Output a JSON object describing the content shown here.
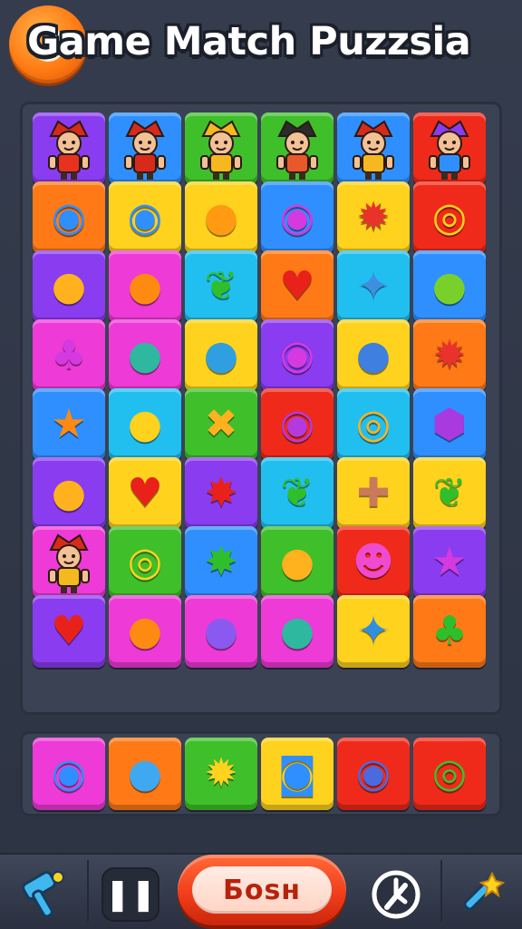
{
  "header": {
    "title": "Game Match Puzzsia",
    "coin_icon": "coin-icon"
  },
  "palette": {
    "purple": "#8a3cf0",
    "blue": "#2f8fff",
    "green": "#3fbf2a",
    "orange": "#ff7a16",
    "yellow": "#ffd21e",
    "red": "#f02a1a",
    "magenta": "#ee3ad6",
    "cyan": "#21bff0",
    "violet": "#8a3cf0"
  },
  "board": {
    "rows": [
      [
        {
          "color": "purple",
          "kind": "character",
          "hat": "#d82a1a",
          "shirt": "#e8321f"
        },
        {
          "color": "blue",
          "kind": "character",
          "hat": "#d82a1a",
          "shirt": "#d82a1a"
        },
        {
          "color": "green",
          "kind": "character",
          "hat": "#f5b81e",
          "shirt": "#f5b81e"
        },
        {
          "color": "green",
          "kind": "character",
          "hat": "#2b2b2b",
          "shirt": "#e8582a"
        },
        {
          "color": "blue",
          "kind": "character",
          "hat": "#d82a1a",
          "shirt": "#f5b81e"
        },
        {
          "color": "red",
          "kind": "character",
          "hat": "#8a3cf0",
          "shirt": "#2f8fff"
        }
      ],
      [
        {
          "color": "orange",
          "kind": "gem",
          "icon": "ring-icon",
          "glyph": "◉",
          "glyph_color": "#2f8fff"
        },
        {
          "color": "yellow",
          "kind": "gem",
          "icon": "ring-icon",
          "glyph": "◉",
          "glyph_color": "#2f8fff"
        },
        {
          "color": "yellow",
          "kind": "gem",
          "icon": "bell-icon",
          "glyph": "●",
          "glyph_color": "#ff9a12"
        },
        {
          "color": "blue",
          "kind": "gem",
          "icon": "ring-icon",
          "glyph": "◉",
          "glyph_color": "#d43ae0"
        },
        {
          "color": "yellow",
          "kind": "gem",
          "icon": "gear-icon",
          "glyph": "✹",
          "glyph_color": "#e8322a"
        },
        {
          "color": "red",
          "kind": "gem",
          "icon": "ring-icon",
          "glyph": "◎",
          "glyph_color": "#ffd21e"
        }
      ],
      [
        {
          "color": "purple",
          "kind": "gem",
          "icon": "bell-icon",
          "glyph": "●",
          "glyph_color": "#ffb21e"
        },
        {
          "color": "magenta",
          "kind": "gem",
          "icon": "bell-icon",
          "glyph": "●",
          "glyph_color": "#ff8a12"
        },
        {
          "color": "cyan",
          "kind": "gem",
          "icon": "leaf-icon",
          "glyph": "❦",
          "glyph_color": "#2fbf2a"
        },
        {
          "color": "orange",
          "kind": "gem",
          "icon": "heart-icon",
          "glyph": "♥",
          "glyph_color": "#e8221a"
        },
        {
          "color": "cyan",
          "kind": "gem",
          "icon": "shell-icon",
          "glyph": "✦",
          "glyph_color": "#3f8fe0"
        },
        {
          "color": "blue",
          "kind": "gem",
          "icon": "drop-icon",
          "glyph": "●",
          "glyph_color": "#7ad02a"
        }
      ],
      [
        {
          "color": "magenta",
          "kind": "gem",
          "icon": "blob-icon",
          "glyph": "♣",
          "glyph_color": "#d43ae0"
        },
        {
          "color": "magenta",
          "kind": "gem",
          "icon": "planet-icon",
          "glyph": "●",
          "glyph_color": "#2fb8a0"
        },
        {
          "color": "yellow",
          "kind": "gem",
          "icon": "drop-icon",
          "glyph": "●",
          "glyph_color": "#2f9fe0"
        },
        {
          "color": "purple",
          "kind": "gem",
          "icon": "ring-icon",
          "glyph": "◉",
          "glyph_color": "#d43ae0"
        },
        {
          "color": "yellow",
          "kind": "gem",
          "icon": "planet-icon",
          "glyph": "●",
          "glyph_color": "#3f7fe0"
        },
        {
          "color": "orange",
          "kind": "gem",
          "icon": "gear-icon",
          "glyph": "✹",
          "glyph_color": "#e8322a"
        }
      ],
      [
        {
          "color": "blue",
          "kind": "gem",
          "icon": "star-icon",
          "glyph": "★",
          "glyph_color": "#ff8a12"
        },
        {
          "color": "cyan",
          "kind": "gem",
          "icon": "drop-icon",
          "glyph": "●",
          "glyph_color": "#ffd21e"
        },
        {
          "color": "green",
          "kind": "gem",
          "icon": "cross-icon",
          "glyph": "✖",
          "glyph_color": "#ffb21e"
        },
        {
          "color": "red",
          "kind": "gem",
          "icon": "ring-icon",
          "glyph": "◉",
          "glyph_color": "#b43ae0"
        },
        {
          "color": "cyan",
          "kind": "gem",
          "icon": "spiral-icon",
          "glyph": "◎",
          "glyph_color": "#ffb21e"
        },
        {
          "color": "blue",
          "kind": "gem",
          "icon": "wand-icon",
          "glyph": "⬢",
          "glyph_color": "#a83ae0"
        }
      ],
      [
        {
          "color": "purple",
          "kind": "gem",
          "icon": "bell-icon",
          "glyph": "●",
          "glyph_color": "#ffb21e"
        },
        {
          "color": "yellow",
          "kind": "gem",
          "icon": "heart-icon",
          "glyph": "♥",
          "glyph_color": "#e8221a"
        },
        {
          "color": "purple",
          "kind": "gem",
          "icon": "star-icon",
          "glyph": "✸",
          "glyph_color": "#e8221a"
        },
        {
          "color": "cyan",
          "kind": "gem",
          "icon": "leaf-icon",
          "glyph": "❦",
          "glyph_color": "#2fbf2a"
        },
        {
          "color": "yellow",
          "kind": "gem",
          "icon": "mushroom-icon",
          "glyph": "✚",
          "glyph_color": "#c87a5a"
        },
        {
          "color": "yellow",
          "kind": "gem",
          "icon": "leaf-icon",
          "glyph": "❦",
          "glyph_color": "#2fbf2a"
        }
      ],
      [
        {
          "color": "magenta",
          "kind": "character",
          "hat": "#d82a1a",
          "shirt": "#f5b81e"
        },
        {
          "color": "green",
          "kind": "gem",
          "icon": "ring-icon",
          "glyph": "◎",
          "glyph_color": "#ffd21e"
        },
        {
          "color": "blue",
          "kind": "gem",
          "icon": "leaf-icon",
          "glyph": "✸",
          "glyph_color": "#2fbf2a"
        },
        {
          "color": "green",
          "kind": "gem",
          "icon": "drop-icon",
          "glyph": "●",
          "glyph_color": "#ffb21e"
        },
        {
          "color": "red",
          "kind": "gem",
          "icon": "face-icon",
          "glyph": "☻",
          "glyph_color": "#f04ad0"
        },
        {
          "color": "violet",
          "kind": "gem",
          "icon": "star-icon",
          "glyph": "★",
          "glyph_color": "#d43ae0"
        }
      ],
      [
        {
          "color": "purple",
          "kind": "gem",
          "icon": "apple-icon",
          "glyph": "♥",
          "glyph_color": "#e8221a"
        },
        {
          "color": "magenta",
          "kind": "gem",
          "icon": "bell-icon",
          "glyph": "●",
          "glyph_color": "#ff8a12"
        },
        {
          "color": "magenta",
          "kind": "gem",
          "icon": "planet-icon",
          "glyph": "●",
          "glyph_color": "#8a5af0"
        },
        {
          "color": "magenta",
          "kind": "gem",
          "icon": "planet-icon",
          "glyph": "●",
          "glyph_color": "#2fb8a0"
        },
        {
          "color": "yellow",
          "kind": "gem",
          "icon": "fish-icon",
          "glyph": "✦",
          "glyph_color": "#2f8fe0"
        },
        {
          "color": "orange",
          "kind": "gem",
          "icon": "leaf-icon",
          "glyph": "♣",
          "glyph_color": "#2fbf2a"
        }
      ]
    ]
  },
  "tray": {
    "tiles": [
      {
        "color": "magenta",
        "kind": "gem",
        "icon": "ring-icon",
        "glyph": "◉",
        "glyph_color": "#2f8fff"
      },
      {
        "color": "orange",
        "kind": "gem",
        "icon": "orb-icon",
        "glyph": "●",
        "glyph_color": "#3fa8f0"
      },
      {
        "color": "green",
        "kind": "gem",
        "icon": "gear-icon",
        "glyph": "✹",
        "glyph_color": "#ffd21e"
      },
      {
        "color": "yellow",
        "kind": "gem",
        "icon": "ring-icon",
        "glyph": "◙",
        "glyph_color": "#2f8fff"
      },
      {
        "color": "red",
        "kind": "gem",
        "icon": "ring-icon",
        "glyph": "◉",
        "glyph_color": "#4a6ae0"
      },
      {
        "color": "red",
        "kind": "gem",
        "icon": "ring-icon",
        "glyph": "◎",
        "glyph_color": "#3fbf2a"
      }
    ]
  },
  "bottom_bar": {
    "left_icon": "hammer-icon",
    "pause_label": "❚❚",
    "main_label": "Бosн",
    "undo_icon": "undo-icon",
    "right_icon": "magic-wand-icon"
  }
}
